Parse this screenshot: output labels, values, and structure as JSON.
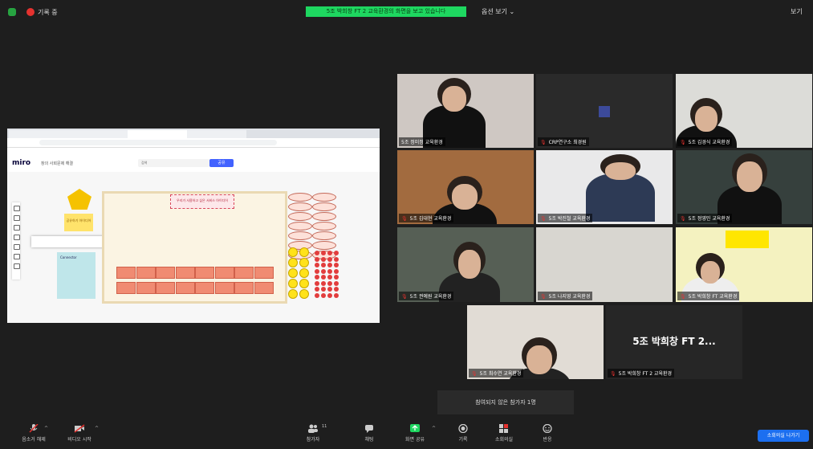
{
  "topbar": {
    "recording_label": "기록 중",
    "banner_text": "5조 박희창 FT 2 교육환경의 화면을 보고 있습니다",
    "view_options": "옵션 보기 ⌄",
    "view_label": "보기"
  },
  "shared_screen": {
    "miro_logo": "miro",
    "board_name": "창의 사회문제 해결",
    "share_label": "공유",
    "search_placeholder": "검색",
    "frame_note": "우리가 사용하고 싶은 서비스 아이디어",
    "yellow_note": "공유하기 아이디어",
    "blue_note": "Connector"
  },
  "tiles": [
    {
      "name": "5조 정미정 교육환경",
      "muted": false
    },
    {
      "name": "CRP연구소 최경원",
      "muted": true
    },
    {
      "name": "5조 김경식 교육환경",
      "muted": true
    },
    {
      "name": "5조 김대현 교육환경",
      "muted": true
    },
    {
      "name": "5조 박진철 교육환경",
      "muted": true
    },
    {
      "name": "5조 정영민 교육환경",
      "muted": true
    },
    {
      "name": "5조 권예원 교육환경",
      "muted": true
    },
    {
      "name": "5조 나지영 교육환경",
      "muted": true
    },
    {
      "name": "5조 박희창 FT 교육환경",
      "muted": true
    },
    {
      "name": "5조 최수연 교육환경",
      "muted": true
    },
    {
      "name": "5조 박희창 FT 2 교육환경",
      "muted": true
    }
  ],
  "big_name": "5조 박희창 FT 2...",
  "caption": "참여되지 않은 참가자 1명",
  "toolbar": {
    "mute": "음소거 해제",
    "video": "비디오 시작",
    "participants": "참가자",
    "participants_count": "11",
    "chat": "채팅",
    "share": "화면 공유",
    "record": "기록",
    "breakout": "소회의실",
    "reactions": "반응",
    "end": "소회의실 나가기"
  },
  "colors": {
    "share_green": "#1ed760",
    "end_blue": "#1c6ff0",
    "mute_red": "#e5322f"
  }
}
